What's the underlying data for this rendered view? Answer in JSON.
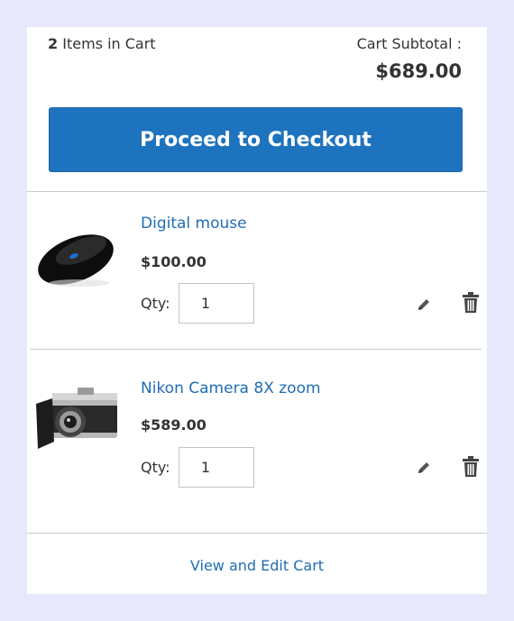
{
  "cart": {
    "items_count": "2",
    "items_label": "Items in Cart",
    "subtotal_label": "Cart Subtotal :",
    "subtotal_amount": "$689.00",
    "checkout_label": "Proceed to Checkout"
  },
  "items": [
    {
      "name": "Digital mouse",
      "price": "$100.00",
      "qty_label": "Qty:",
      "qty": "1",
      "image_icon": "mouse-product-image"
    },
    {
      "name": "Nikon Camera 8X zoom",
      "price": "$589.00",
      "qty_label": "Qty:",
      "qty": "1",
      "image_icon": "camera-product-image"
    }
  ],
  "footer": {
    "view_edit_label": "View and Edit Cart"
  },
  "colors": {
    "link": "#1f6db5",
    "button": "#1e73be",
    "background": "#e8e8fc"
  }
}
